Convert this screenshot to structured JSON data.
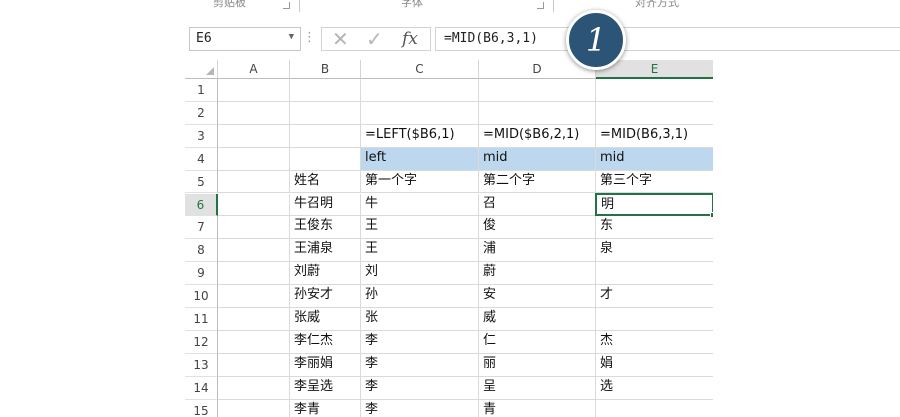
{
  "ribbon": {
    "groups": [
      {
        "label": "剪贴板"
      },
      {
        "label": "字体"
      },
      {
        "label": "对齐方式"
      }
    ]
  },
  "formula_bar": {
    "name_box": "E6",
    "dots": "⋮",
    "cancel_icon": "✕",
    "enter_icon": "✓",
    "insert_function_label": "fx",
    "formula": "=MID(B6,3,1)"
  },
  "step_badge": {
    "label": "1"
  },
  "active_cell": {
    "col": 4,
    "row": 6
  },
  "columns": [
    "A",
    "B",
    "C",
    "D",
    "E"
  ],
  "rows": [
    {
      "num": "1",
      "cells": [
        "",
        "",
        "",
        "",
        ""
      ]
    },
    {
      "num": "2",
      "cells": [
        "",
        "",
        "",
        "",
        ""
      ]
    },
    {
      "num": "3",
      "cells": [
        "",
        "",
        "=LEFT($B6,1)",
        "=MID($B6,2,1)",
        "=MID(B6,3,1)"
      ]
    },
    {
      "num": "4",
      "cells": [
        "",
        "",
        "left",
        "mid",
        "mid"
      ],
      "highlight": [
        2,
        3,
        4
      ]
    },
    {
      "num": "5",
      "cells": [
        "",
        "姓名",
        "第一个字",
        "第二个字",
        "第三个字"
      ]
    },
    {
      "num": "6",
      "cells": [
        "",
        "牛召明",
        "牛",
        "召",
        "明"
      ]
    },
    {
      "num": "7",
      "cells": [
        "",
        "王俊东",
        "王",
        "俊",
        "东"
      ]
    },
    {
      "num": "8",
      "cells": [
        "",
        "王浦泉",
        "王",
        "浦",
        "泉"
      ]
    },
    {
      "num": "9",
      "cells": [
        "",
        "刘蔚",
        "刘",
        "蔚",
        ""
      ]
    },
    {
      "num": "10",
      "cells": [
        "",
        "孙安才",
        "孙",
        "安",
        "才"
      ]
    },
    {
      "num": "11",
      "cells": [
        "",
        "张威",
        "张",
        "威",
        ""
      ]
    },
    {
      "num": "12",
      "cells": [
        "",
        "李仁杰",
        "李",
        "仁",
        "杰"
      ]
    },
    {
      "num": "13",
      "cells": [
        "",
        "李丽娟",
        "李",
        "丽",
        "娟"
      ]
    },
    {
      "num": "14",
      "cells": [
        "",
        "李呈选",
        "李",
        "呈",
        "选"
      ]
    },
    {
      "num": "15",
      "cells": [
        "",
        "李青",
        "李",
        "青",
        ""
      ]
    }
  ]
}
